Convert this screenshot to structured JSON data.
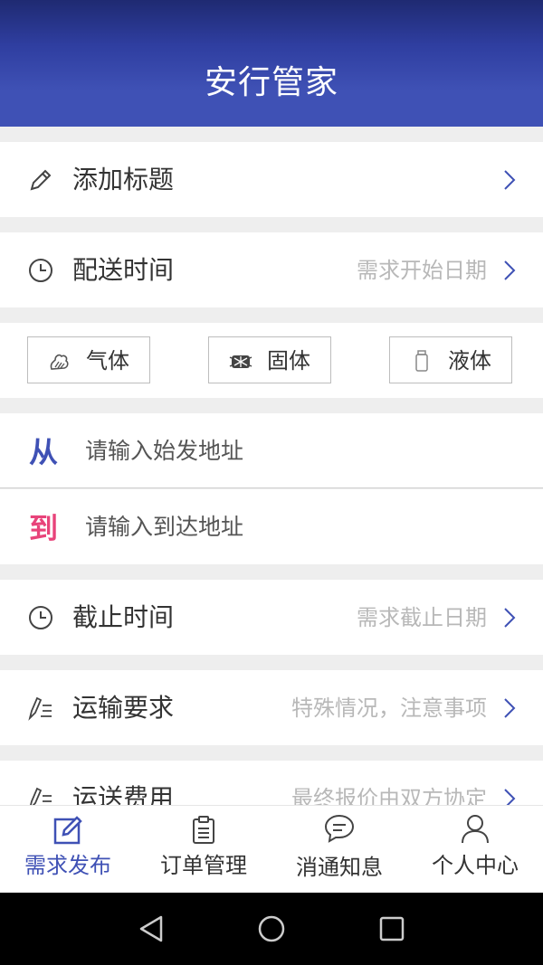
{
  "app": {
    "title": "安行管家"
  },
  "form": {
    "title_row": {
      "label": "添加标题",
      "hint": ""
    },
    "delivery_time": {
      "label": "配送时间",
      "hint": "需求开始日期"
    },
    "cargo_states": [
      {
        "label": "气体",
        "icon": "gas-icon"
      },
      {
        "label": "固体",
        "icon": "solid-icon"
      },
      {
        "label": "液体",
        "icon": "liquid-icon"
      }
    ],
    "from": {
      "mark": "从",
      "placeholder": "请输入始发地址",
      "mark_color": "#3f51b5"
    },
    "to": {
      "mark": "到",
      "placeholder": "请输入到达地址",
      "mark_color": "#e8437a"
    },
    "deadline": {
      "label": "截止时间",
      "hint": "需求截止日期"
    },
    "requirements": {
      "label": "运输要求",
      "hint": "特殊情况，注意事项"
    },
    "fee": {
      "label": "运送费用",
      "hint": "最终报价由双方协定"
    }
  },
  "tabs": [
    {
      "label": "需求发布",
      "icon": "edit-square-icon",
      "active": true
    },
    {
      "label": "订单管理",
      "icon": "clipboard-icon",
      "active": false
    },
    {
      "label": "消通知息",
      "icon": "chat-bubble-icon",
      "active": false
    },
    {
      "label": "个人中心",
      "icon": "person-icon",
      "active": false
    }
  ],
  "colors": {
    "primary": "#3f51b5",
    "accent_pink": "#e8437a",
    "background": "#eeeeee",
    "hint_text": "#b8b8b8"
  }
}
